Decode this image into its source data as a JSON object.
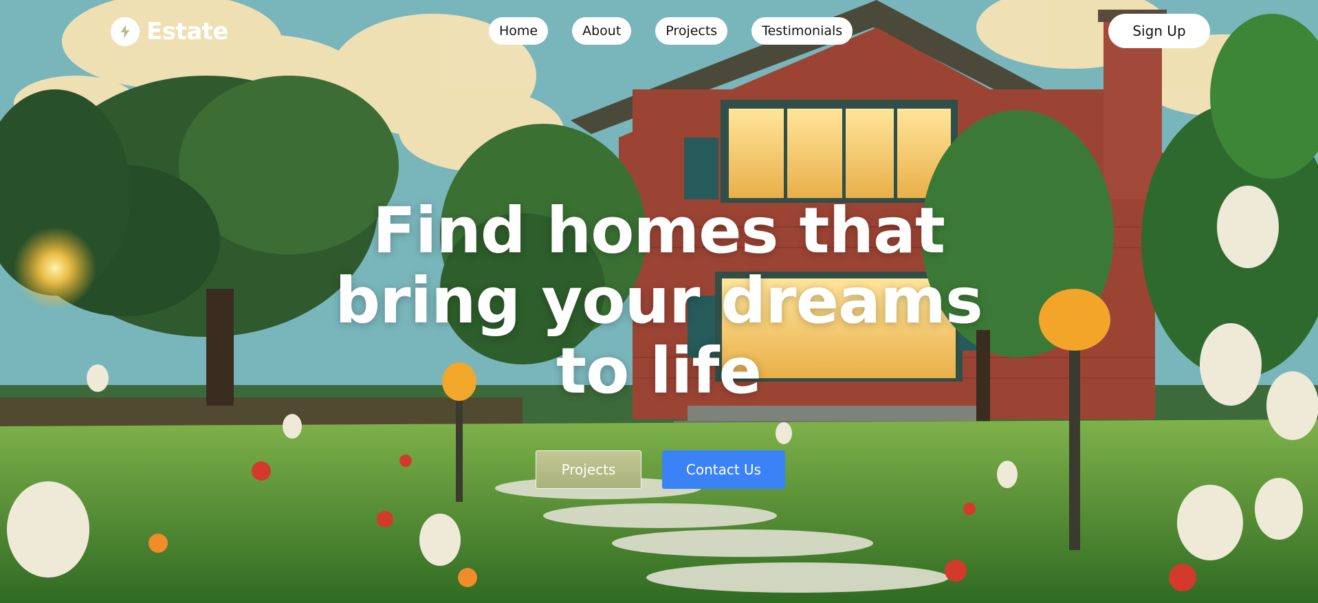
{
  "brand": {
    "name": "Estate",
    "logo_icon": "lightning-bolt-icon"
  },
  "nav": {
    "links": [
      {
        "label": "Home"
      },
      {
        "label": "About"
      },
      {
        "label": "Projects"
      },
      {
        "label": "Testimonials"
      }
    ],
    "signup_label": "Sign Up"
  },
  "hero": {
    "headline_lines": [
      "Find homes that",
      "bring your dreams",
      "to life"
    ],
    "buttons": {
      "projects_label": "Projects",
      "contact_label": "Contact Us"
    }
  },
  "colors": {
    "primary_button": "#3b82f6",
    "secondary_button": "#b7bd86",
    "text_on_image": "#ffffff",
    "nav_pill": "#ffffff"
  }
}
